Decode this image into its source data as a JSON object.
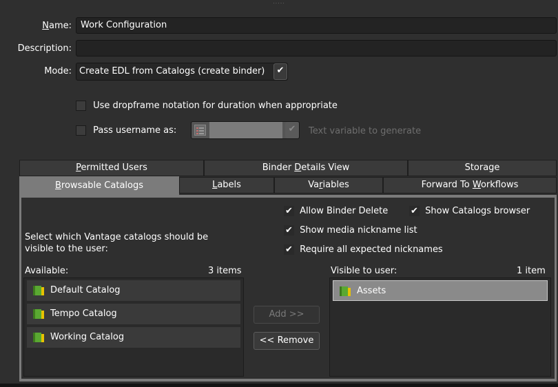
{
  "header": {
    "name_label": "Name:",
    "name_value": "Work Configuration",
    "description_label": "Description:",
    "description_value": "",
    "mode_label": "Mode:",
    "mode_value": "Create EDL from Catalogs (create binder)"
  },
  "options": {
    "dropframe_label": "Use dropframe notation for duration when appropriate",
    "dropframe_checked": false,
    "pass_username_label": "Pass username as:",
    "pass_username_checked": false,
    "variable_placeholder": "Text variable to generate"
  },
  "tabs_row1": [
    {
      "label": "Permitted Users",
      "accesskey_index": 0
    },
    {
      "label": "Binder Details View",
      "accesskey_index": 7
    },
    {
      "label": "Storage",
      "accesskey_index": -1
    }
  ],
  "tabs_row2": [
    {
      "label": "Browsable Catalogs",
      "active": true
    },
    {
      "label": "Labels"
    },
    {
      "label": "Variables"
    },
    {
      "label": "Forward To Workflows"
    }
  ],
  "catalogs": {
    "instructions": "Select which Vantage catalogs should be visible to the user:",
    "allow_binder_delete": "Allow Binder Delete",
    "show_catalogs_browser": "Show Catalogs browser",
    "show_media_nickname": "Show media nickname list",
    "require_nicknames": "Require all expected nicknames",
    "available_label": "Available:",
    "available_count": "3 items",
    "available_items": [
      "Default Catalog",
      "Tempo Catalog",
      "Working Catalog"
    ],
    "visible_label": "Visible to user:",
    "visible_count": "1 item",
    "visible_items": [
      "Assets"
    ],
    "add_button": "Add >>",
    "remove_button": "<< Remove"
  },
  "colors": {
    "background": "#2f2f2f",
    "active_tab": "#7b7b7b",
    "selected_item": "#8a8a8a",
    "catalog_icon": "#5aa832"
  }
}
